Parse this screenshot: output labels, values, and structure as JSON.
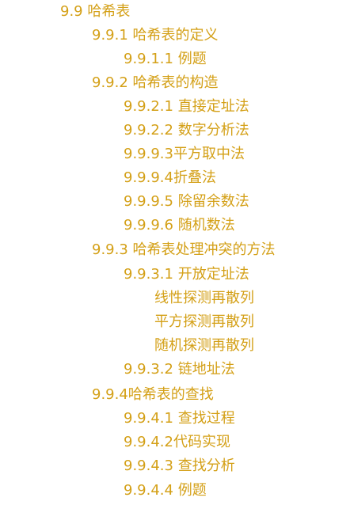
{
  "toc": {
    "items": [
      "9.9 哈希表",
      "9.9.1 哈希表的定义",
      "9.9.1.1 例题",
      "9.9.2 哈希表的构造",
      "9.9.2.1 直接定址法",
      "9.9.2.2 数字分析法",
      "9.9.9.3平方取中法",
      "9.9.9.4折叠法",
      "9.9.9.5 除留余数法",
      "9.9.9.6 随机数法",
      "9.9.3 哈希表处理冲突的方法",
      "9.9.3.1 开放定址法",
      "线性探测再散列",
      "平方探测再散列",
      "随机探测再散列",
      "9.9.3.2 链地址法",
      "9.9.4哈希表的查找",
      "9.9.4.1 查找过程",
      "9.9.4.2代码实现",
      "9.9.4.3 查找分析",
      "9.9.4.4 例题"
    ]
  }
}
